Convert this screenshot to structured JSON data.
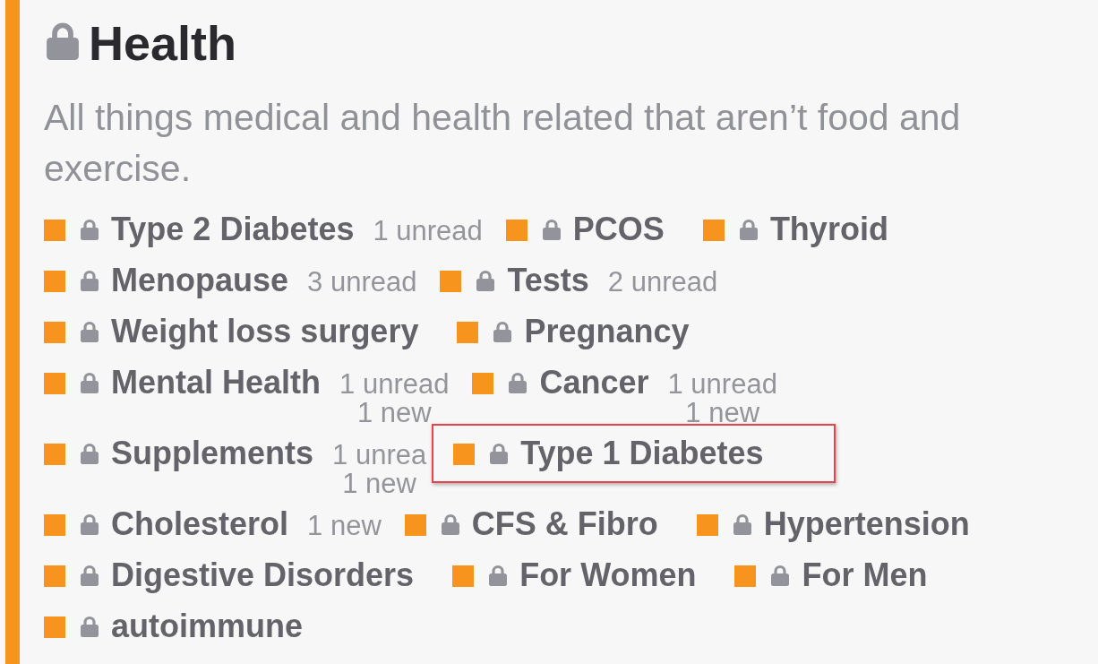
{
  "category": {
    "name": "Health",
    "locked": true,
    "color": "#f7941d",
    "description": "All things medical and health related that aren’t food and exercise."
  },
  "rows": [
    {
      "items": [
        {
          "name": "Type 2 Diabetes",
          "locked": true,
          "color": "#f7941d",
          "highlighted": false,
          "stats": [
            "1 unread"
          ]
        },
        {
          "name": "PCOS",
          "locked": true,
          "color": "#f7941d",
          "highlighted": false
        },
        {
          "name": "Thyroid",
          "locked": true,
          "color": "#f7941d",
          "highlighted": false
        }
      ]
    },
    {
      "items": [
        {
          "name": "Menopause",
          "locked": true,
          "color": "#f7941d",
          "highlighted": false,
          "stats": [
            "3 unread"
          ]
        },
        {
          "name": "Tests",
          "locked": true,
          "color": "#f7941d",
          "highlighted": false,
          "stats": [
            "2 unread"
          ]
        }
      ]
    },
    {
      "items": [
        {
          "name": "Weight loss surgery",
          "locked": true,
          "color": "#f7941d",
          "highlighted": false
        },
        {
          "name": "Pregnancy",
          "locked": true,
          "color": "#f7941d",
          "highlighted": false
        }
      ]
    },
    {
      "items": [
        {
          "name": "Mental Health",
          "locked": true,
          "color": "#f7941d",
          "highlighted": false,
          "stats": [
            "1 unread",
            "1 new"
          ]
        },
        {
          "name": "Cancer",
          "locked": true,
          "color": "#f7941d",
          "highlighted": false,
          "stats": [
            "1 unread",
            "1 new"
          ]
        }
      ]
    },
    {
      "items": [
        {
          "name": "Supplements",
          "locked": true,
          "color": "#f7941d",
          "highlighted": false,
          "stats": [
            "1 unrea",
            "1 new"
          ]
        },
        {
          "name": "Type 1 Diabetes",
          "locked": true,
          "color": "#f7941d",
          "highlighted": true
        }
      ]
    },
    {
      "items": [
        {
          "name": "Cholesterol",
          "locked": true,
          "color": "#f7941d",
          "highlighted": false,
          "stats": [
            "1 new"
          ]
        },
        {
          "name": "CFS & Fibro",
          "locked": true,
          "color": "#f7941d",
          "highlighted": false
        },
        {
          "name": "Hypertension",
          "locked": true,
          "color": "#f7941d",
          "highlighted": false
        }
      ]
    },
    {
      "items": [
        {
          "name": "Digestive Disorders",
          "locked": true,
          "color": "#f7941d",
          "highlighted": false
        },
        {
          "name": "For Women",
          "locked": true,
          "color": "#f7941d",
          "highlighted": false
        },
        {
          "name": "For Men",
          "locked": true,
          "color": "#f7941d",
          "highlighted": false
        }
      ]
    },
    {
      "items": [
        {
          "name": "autoimmune",
          "locked": true,
          "color": "#f7941d",
          "highlighted": false
        }
      ]
    }
  ]
}
